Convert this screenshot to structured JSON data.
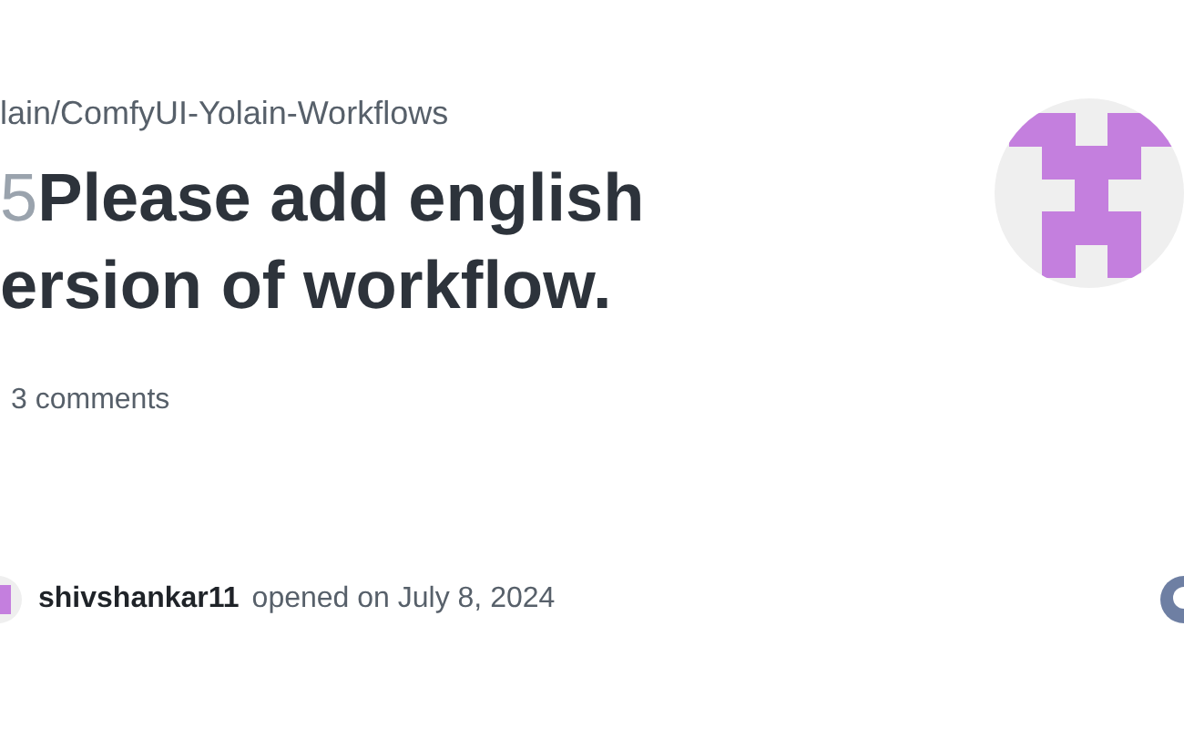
{
  "repo": "lain/ComfyUI-Yolain-Workflows",
  "issue": {
    "number": "5",
    "title_lines": [
      "Please add english",
      "ersion of workflow."
    ]
  },
  "comments": "3 comments",
  "author": {
    "name": "shivshankar11",
    "opened": "opened on July 8, 2024"
  }
}
